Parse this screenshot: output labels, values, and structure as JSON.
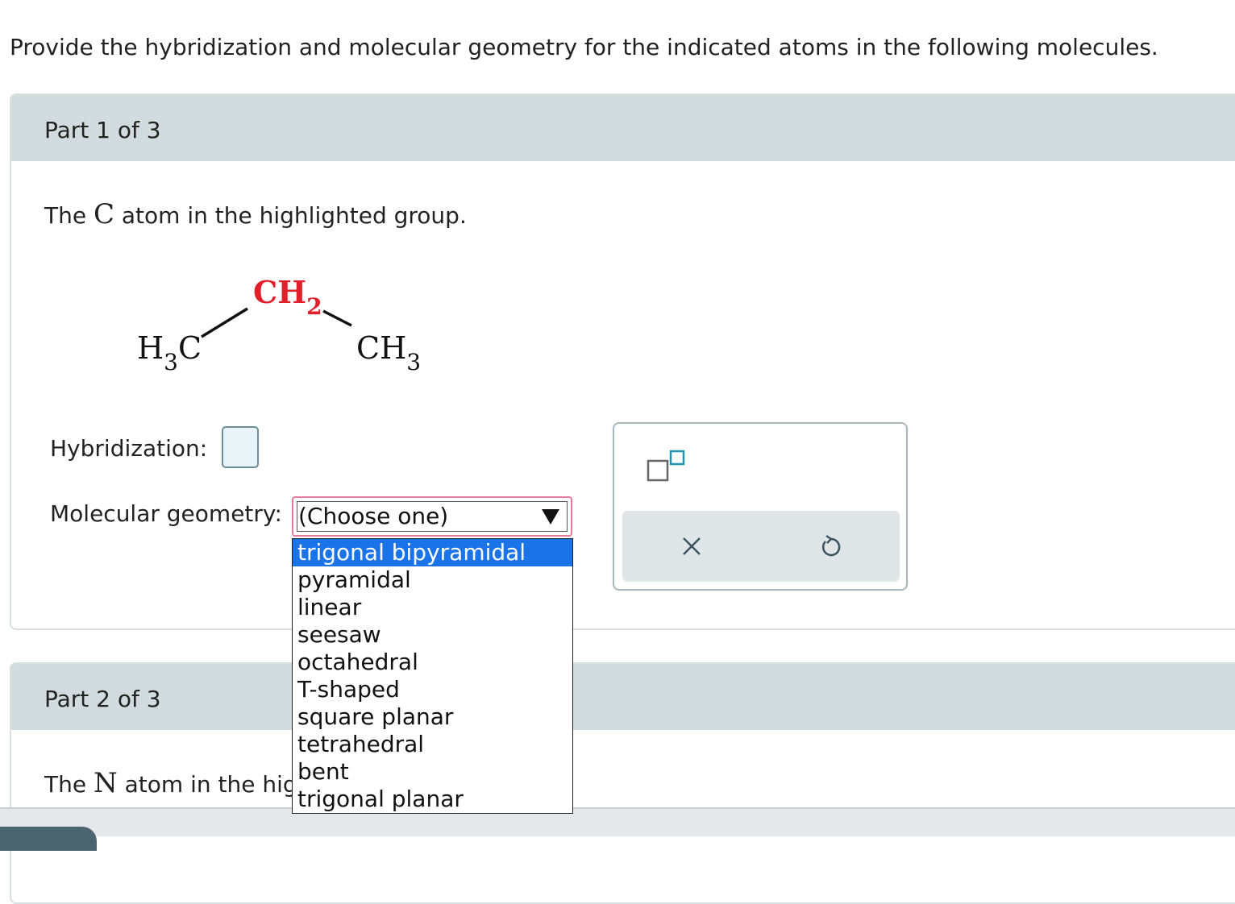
{
  "prompt": "Provide the hybridization and molecular geometry for the indicated atoms in the following molecules.",
  "part1": {
    "title": "Part 1 of 3",
    "question_pre": "The ",
    "atom": "C",
    "question_post": " atom in the highlighted group.",
    "molecule": {
      "left_group": "H",
      "left_sub": "3",
      "left_tail": "C",
      "center_group": "CH",
      "center_sub": "2",
      "right_group": "CH",
      "right_sub": "3",
      "highlight_color": "#e0202a"
    },
    "hybridization_label": "Hybridization:",
    "geometry_label": "Molecular geometry:",
    "geometry_selected": "(Choose one)",
    "geometry_options": [
      "trigonal bipyramidal",
      "pyramidal",
      "linear",
      "seesaw",
      "octahedral",
      "T-shaped",
      "square planar",
      "tetrahedral",
      "bent",
      "trigonal planar"
    ],
    "highlighted_option_index": 0
  },
  "part2": {
    "title": "Part 2 of 3",
    "question_pre": "The ",
    "atom": "N",
    "question_post": " atom in the hig"
  },
  "tools": {
    "superscript_icon": "superscript-box-icon",
    "clear_icon": "close-icon",
    "undo_icon": "undo-icon"
  },
  "colors": {
    "header_bg": "#d2dbdd",
    "select_border": "#e8789e",
    "option_highlight": "#1a73e8"
  }
}
